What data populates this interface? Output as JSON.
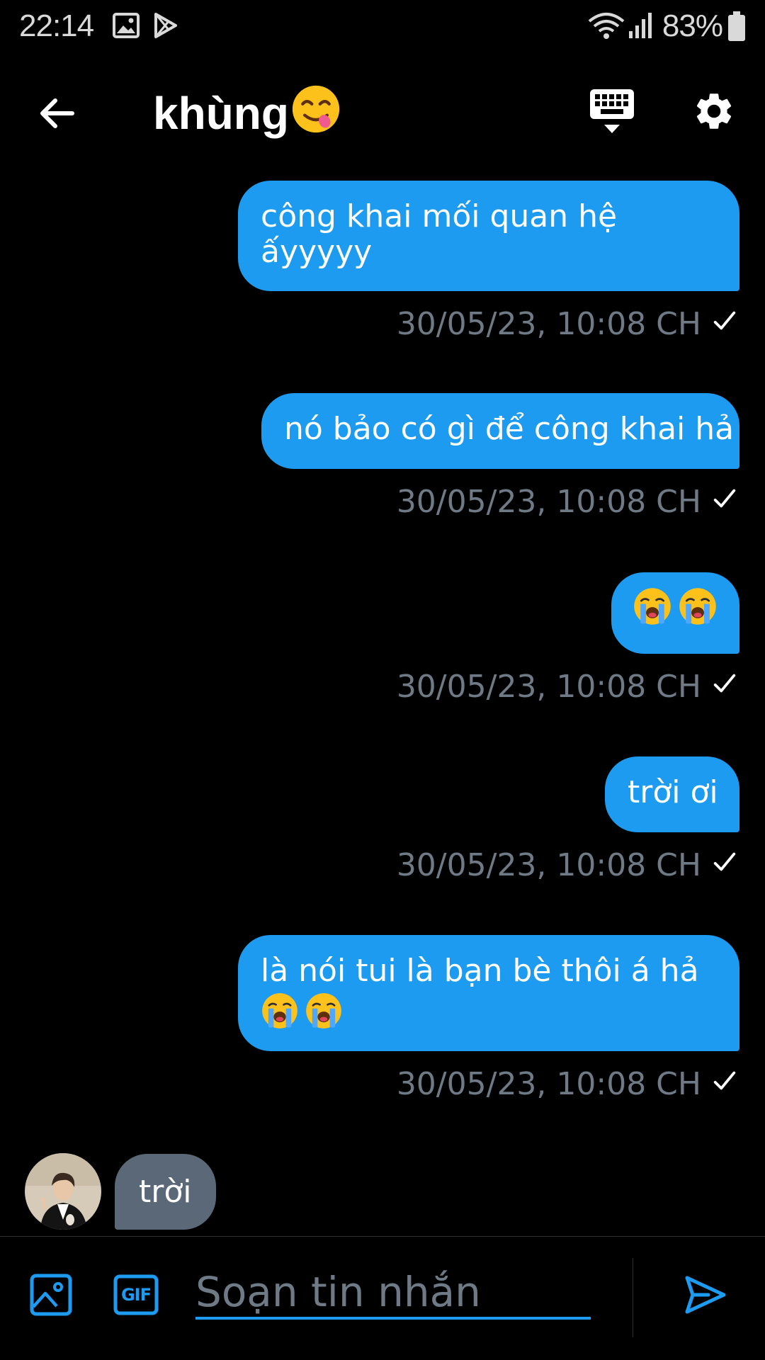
{
  "status_bar": {
    "time": "22:14",
    "battery": "83%",
    "icons": [
      "gallery-icon",
      "play-store-icon",
      "wifi-icon",
      "signal-icon",
      "battery-icon"
    ]
  },
  "header": {
    "title": "khùng",
    "title_emoji": "yum-face-emoji",
    "back_icon": "arrow-left-icon",
    "keyboard_icon": "keyboard-icon",
    "settings_icon": "gear-icon"
  },
  "messages": [
    {
      "text": "công khai mối quan hệ ấyyyyy",
      "emojis": [],
      "timestamp": "30/05/23, 10:08 CH",
      "direction": "outgoing"
    },
    {
      "text": "nó bảo có gì để công khai hả",
      "emojis": [],
      "timestamp": "30/05/23, 10:08 CH",
      "direction": "outgoing"
    },
    {
      "text": "",
      "emojis": [
        "loudly-crying-emoji",
        "loudly-crying-emoji"
      ],
      "timestamp": "30/05/23, 10:08 CH",
      "direction": "outgoing"
    },
    {
      "text": "trời ơi",
      "emojis": [],
      "timestamp": "30/05/23, 10:08 CH",
      "direction": "outgoing"
    },
    {
      "text": "là nói tui là bạn bè thôi á hả",
      "emojis": [
        "loudly-crying-emoji",
        "loudly-crying-emoji"
      ],
      "timestamp": "30/05/23, 10:08 CH",
      "direction": "outgoing"
    }
  ],
  "incoming": {
    "text": "trời",
    "avatar": "user-avatar"
  },
  "composer": {
    "placeholder": "Soạn tin nhắn",
    "value": "",
    "image_icon": "image-icon",
    "gif_icon": "gif-icon",
    "gif_label": "GIF",
    "send_icon": "send-icon"
  },
  "colors": {
    "background": "#000000",
    "bubble_outgoing": "#1d9bf0",
    "bubble_incoming": "#5b6877",
    "timestamp": "#6e7b86",
    "accent": "#1d9bf0"
  }
}
